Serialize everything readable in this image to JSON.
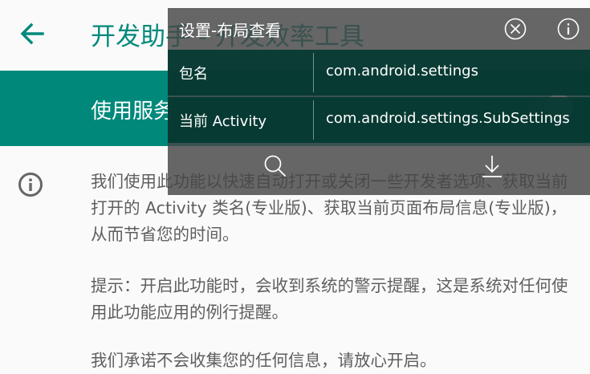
{
  "appbar": {
    "title": "开发助手 - 开发效率工具"
  },
  "service": {
    "label": "使用服务",
    "enabled": true
  },
  "content": {
    "paragraph1": "我们使用此功能以快速自动打开或关闭一些开发者选项、获取当前打开的 Activity 类名(专业版)、获取当前页面布局信息(专业版)，从而节省您的时间。",
    "paragraph2": "提示：开启此功能时，会收到系统的警示提醒，这是系统对任何使用此功能应用的例行提醒。",
    "paragraph3": "我们承诺不会收集您的任何信息，请放心开启。"
  },
  "overlay": {
    "title": "设置-布局查看",
    "rows": [
      {
        "key": "包名",
        "value": "com.android.settings"
      },
      {
        "key": "当前 Activity",
        "value": "com.android.settings.SubSettings"
      }
    ],
    "icons": [
      "close-icon",
      "info-icon",
      "search-icon",
      "download-icon"
    ]
  },
  "colors": {
    "accent": "#00897b",
    "overlay_bg": "#464646",
    "overlay_row": "#003730",
    "body_text": "#5f5f5f"
  }
}
